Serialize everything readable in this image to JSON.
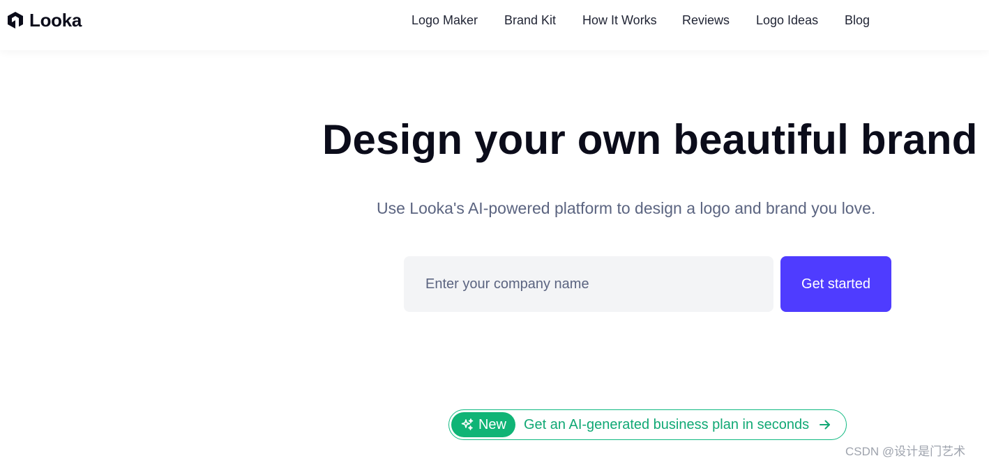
{
  "header": {
    "brand": "Looka",
    "nav": [
      {
        "label": "Logo Maker",
        "name": "nav-logo-maker"
      },
      {
        "label": "Brand Kit",
        "name": "nav-brand-kit"
      },
      {
        "label": "How It Works",
        "name": "nav-how-it-works"
      },
      {
        "label": "Reviews",
        "name": "nav-reviews"
      },
      {
        "label": "Logo Ideas",
        "name": "nav-logo-ideas"
      },
      {
        "label": "Blog",
        "name": "nav-blog"
      }
    ]
  },
  "hero": {
    "title": "Design your own beautiful brand",
    "subtitle": "Use Looka's AI-powered platform to design a logo and brand you love.",
    "input": {
      "value": "",
      "placeholder": "Enter your company name"
    },
    "cta_label": "Get started"
  },
  "promo": {
    "badge": "New",
    "text": "Get an AI-generated business plan in seconds",
    "badge_icon": "sparkles-icon",
    "arrow_icon": "arrow-right-icon"
  },
  "watermark": "CSDN @设计是门艺术",
  "colors": {
    "accent": "#4f3cff",
    "promo_green": "#10b476",
    "text_dark": "#0b0c1a",
    "text_muted": "#5b6480",
    "input_bg": "#f3f4f6"
  }
}
